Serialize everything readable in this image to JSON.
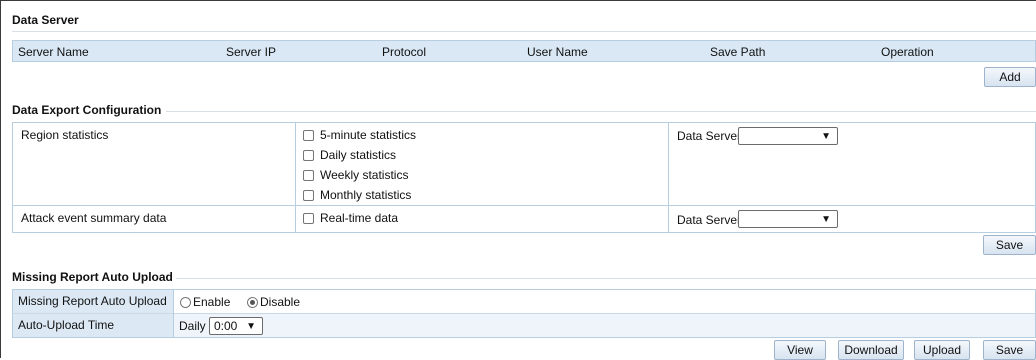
{
  "data_server": {
    "title": "Data Server",
    "columns": [
      "Server Name",
      "Server IP",
      "Protocol",
      "User Name",
      "Save Path",
      "Operation"
    ],
    "add_label": "Add"
  },
  "export_config": {
    "title": "Data Export Configuration",
    "rows": [
      {
        "name": "Region statistics",
        "options": [
          "5-minute statistics",
          "Daily statistics",
          "Weekly statistics",
          "Monthly statistics"
        ],
        "server_label": "Data Server",
        "server_value": ""
      },
      {
        "name": "Attack event summary data",
        "options": [
          "Real-time data"
        ],
        "server_label": "Data Server",
        "server_value": ""
      }
    ],
    "save_label": "Save"
  },
  "missing_report": {
    "title": "Missing Report Auto Upload",
    "auto_upload_label": "Missing Report Auto Upload",
    "enable_label": "Enable",
    "disable_label": "Disable",
    "selected": "Disable",
    "time_label": "Auto-Upload Time",
    "frequency_label": "Daily",
    "time_value": "0:00"
  },
  "footer": {
    "view_label": "View",
    "download_label": "Download",
    "upload_label": "Upload",
    "save_label": "Save"
  },
  "colors": {
    "header_bg": "#d9e8f4",
    "label_bg": "#dce9f5",
    "row_alt_bg": "#eef4fa",
    "border": "#b7cde0"
  }
}
